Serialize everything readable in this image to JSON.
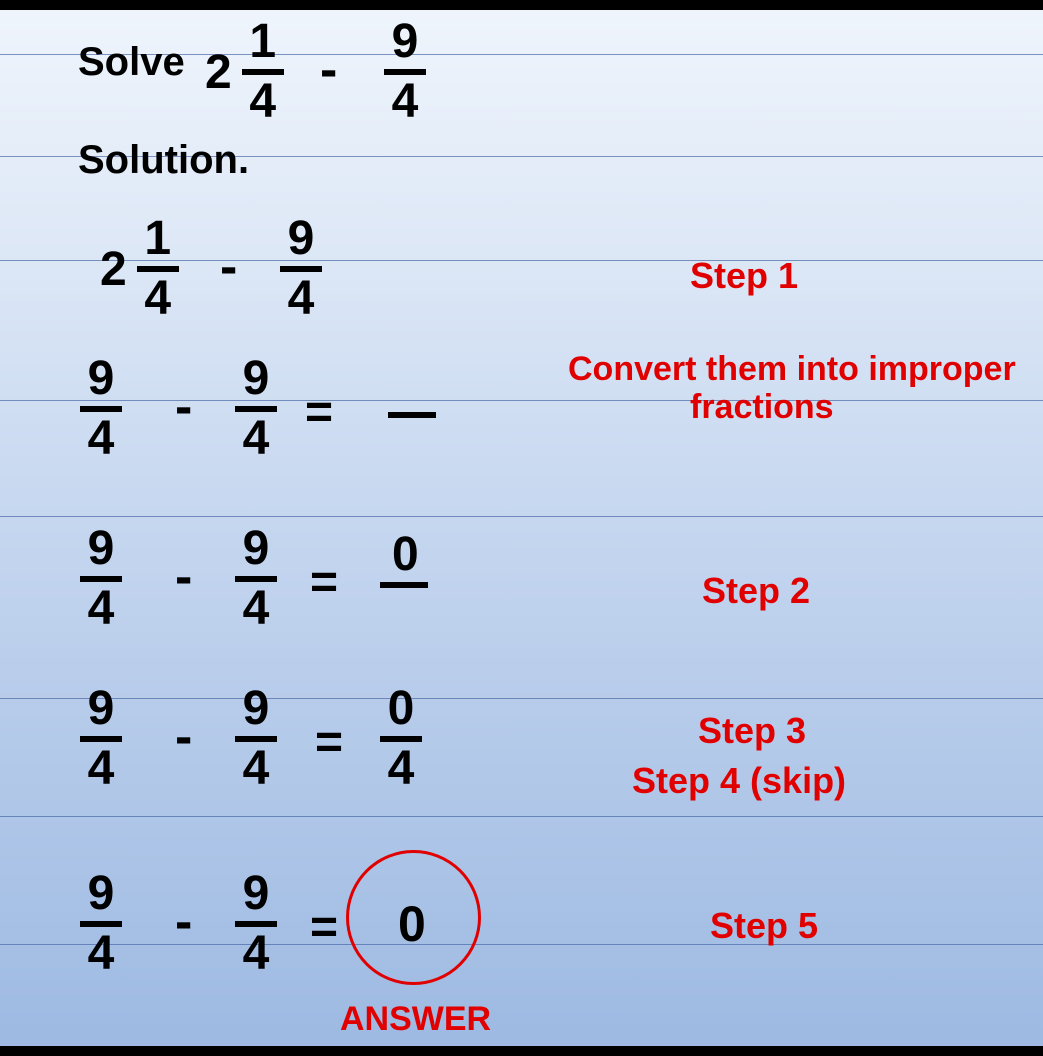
{
  "problem": {
    "solve_label": "Solve",
    "mixed": {
      "whole": "2",
      "num": "1",
      "den": "4"
    },
    "op": "-",
    "rhs": {
      "num": "9",
      "den": "4"
    }
  },
  "solution_label": "Solution.",
  "steps": {
    "row1": {
      "lhs_mixed": {
        "whole": "2",
        "num": "1",
        "den": "4"
      },
      "op": "-",
      "rhs": {
        "num": "9",
        "den": "4"
      },
      "note1": "Step 1",
      "note2": "Convert them into improper",
      "note3": "fractions"
    },
    "row2": {
      "lhs": {
        "num": "9",
        "den": "4"
      },
      "op": "-",
      "rhs": {
        "num": "9",
        "den": "4"
      },
      "eq": "="
    },
    "row3": {
      "lhs": {
        "num": "9",
        "den": "4"
      },
      "op": "-",
      "rhs": {
        "num": "9",
        "den": "4"
      },
      "eq": "=",
      "result_num": "0",
      "note": "Step 2"
    },
    "row4": {
      "lhs": {
        "num": "9",
        "den": "4"
      },
      "op": "-",
      "rhs": {
        "num": "9",
        "den": "4"
      },
      "eq": "=",
      "result": {
        "num": "0",
        "den": "4"
      },
      "note1": "Step 3",
      "note2": "Step 4 (skip)"
    },
    "row5": {
      "lhs": {
        "num": "9",
        "den": "4"
      },
      "op": "-",
      "rhs": {
        "num": "9",
        "den": "4"
      },
      "eq": "=",
      "result": "0",
      "note": "Step 5",
      "answer_label": "ANSWER"
    }
  }
}
